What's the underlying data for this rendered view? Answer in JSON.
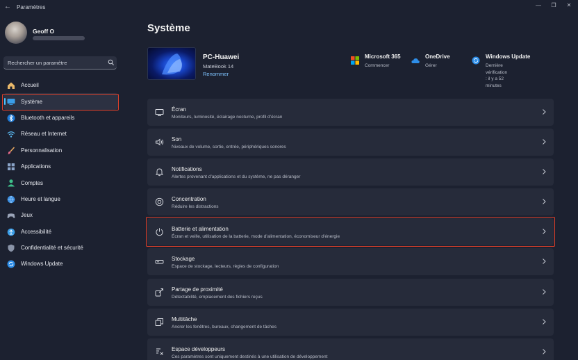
{
  "window": {
    "title": "Paramètres",
    "back_glyph": "←",
    "minimize_glyph": "—",
    "maximize_glyph": "❐",
    "close_glyph": "✕"
  },
  "user": {
    "name": "Geoff O"
  },
  "search": {
    "placeholder": "Rechercher un paramètre"
  },
  "nav": {
    "items": [
      {
        "label": "Accueil",
        "icon": "home-icon"
      },
      {
        "label": "Système",
        "icon": "system-icon",
        "selected": true
      },
      {
        "label": "Bluetooth et appareils",
        "icon": "bluetooth-icon"
      },
      {
        "label": "Réseau et Internet",
        "icon": "wifi-icon"
      },
      {
        "label": "Personnalisation",
        "icon": "brush-icon"
      },
      {
        "label": "Applications",
        "icon": "apps-icon"
      },
      {
        "label": "Comptes",
        "icon": "account-icon"
      },
      {
        "label": "Heure et langue",
        "icon": "globe-clock-icon"
      },
      {
        "label": "Jeux",
        "icon": "gamepad-icon"
      },
      {
        "label": "Accessibilité",
        "icon": "accessibility-icon"
      },
      {
        "label": "Confidentialité et sécurité",
        "icon": "shield-icon"
      },
      {
        "label": "Windows Update",
        "icon": "update-icon"
      }
    ]
  },
  "main": {
    "title": "Système",
    "device": {
      "name": "PC-Huawei",
      "model": "MateBook 14",
      "rename": "Renommer"
    },
    "services": [
      {
        "name": "Microsoft 365",
        "sub": "Commencer",
        "icon": "microsoft-icon"
      },
      {
        "name": "OneDrive",
        "sub": "Gérer",
        "icon": "cloud-icon"
      },
      {
        "name": "Windows Update",
        "sub_line1": "Dernière vérification : il y a 52",
        "sub_line2": "minutes",
        "icon": "update-icon"
      }
    ],
    "settings": [
      {
        "title": "Écran",
        "desc": "Moniteurs, luminosité, éclairage nocturne, profil d’écran",
        "icon": "display-icon"
      },
      {
        "title": "Son",
        "desc": "Niveaux de volume, sortie, entrée, périphériques sonores",
        "icon": "speaker-icon"
      },
      {
        "title": "Notifications",
        "desc": "Alertes provenant d’applications et du système, ne pas déranger",
        "icon": "bell-icon"
      },
      {
        "title": "Concentration",
        "desc": "Réduire les distractions",
        "icon": "focus-icon"
      },
      {
        "title": "Batterie et alimentation",
        "desc": "Écran et veille, utilisation de la batterie, mode d’alimentation, économiseur d’énergie",
        "icon": "power-icon"
      },
      {
        "title": "Stockage",
        "desc": "Espace de stockage, lecteurs, règles de configuration",
        "icon": "storage-icon"
      },
      {
        "title": "Partage de proximité",
        "desc": "Détectabilité, emplacement des fichiers reçus",
        "icon": "share-icon"
      },
      {
        "title": "Multitâche",
        "desc": "Ancrer les fenêtres, bureaux, changement de tâches",
        "icon": "multitask-icon"
      },
      {
        "title": "Espace développeurs",
        "desc": "Ces paramètres sont uniquement destinés à une utilisation de développement",
        "icon": "developer-icon"
      }
    ]
  },
  "colors": {
    "accent": "#4cc2ff",
    "highlight": "#e0402a",
    "background": "#1c2130",
    "card": "#262b3a"
  }
}
